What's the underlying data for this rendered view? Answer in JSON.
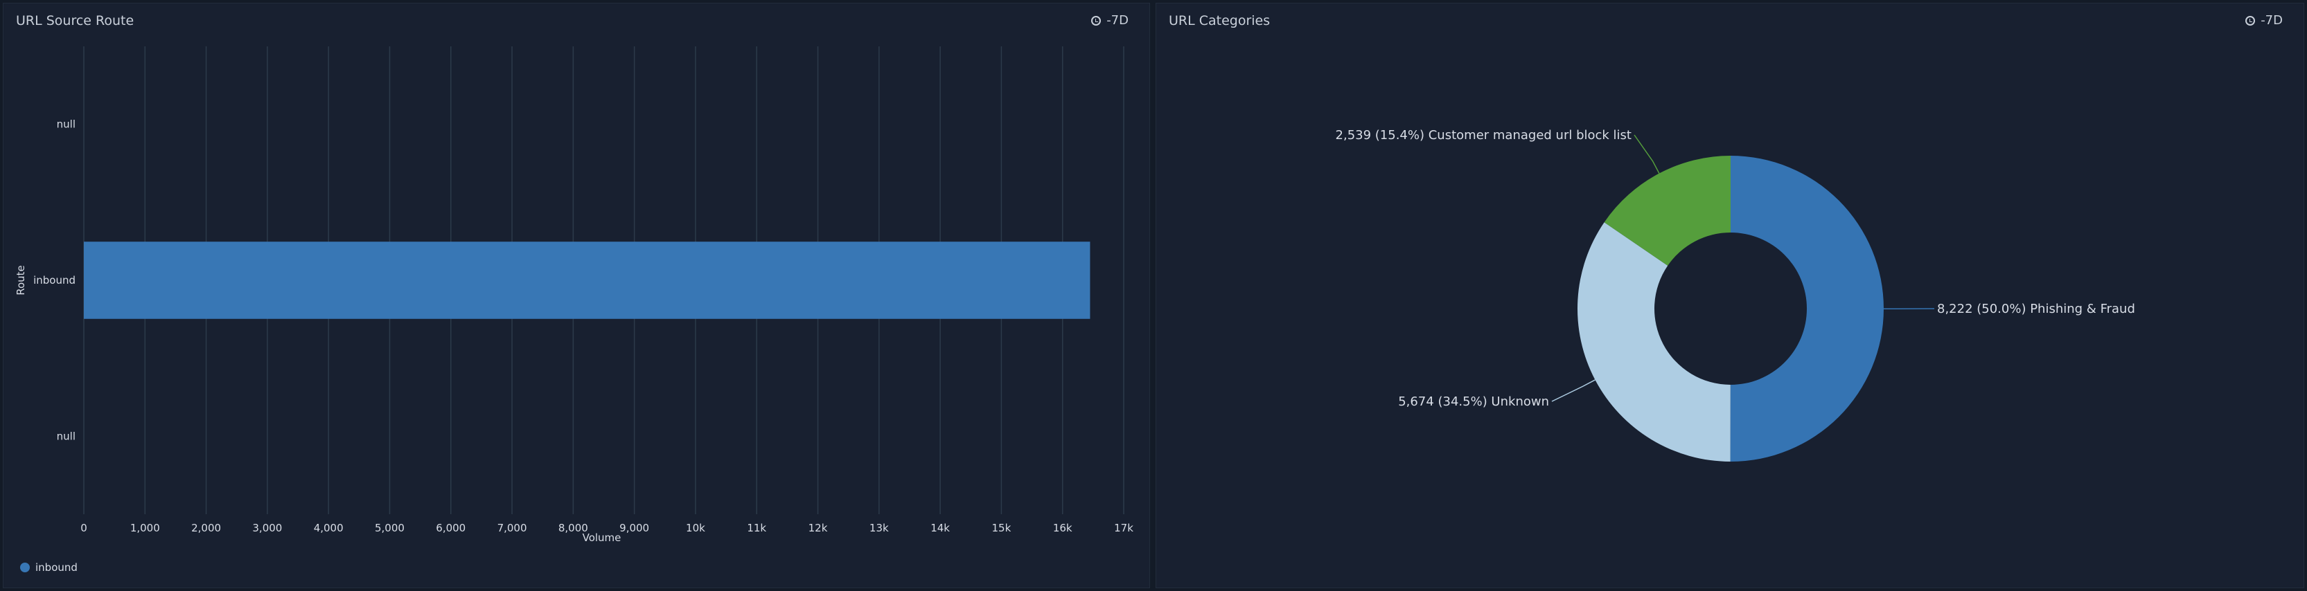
{
  "left_panel": {
    "title": "URL Source Route",
    "time_range": "-7D",
    "legend_label": "inbound"
  },
  "right_panel": {
    "title": "URL Categories",
    "time_range": "-7D"
  },
  "colors": {
    "bar": "#3877b5",
    "phishing": "#3574b3",
    "unknown": "#aecde3",
    "blocklist": "#559e3c",
    "grid": "#2c3a4a",
    "text": "#d8dde6"
  },
  "chart_data": [
    {
      "type": "bar",
      "orientation": "horizontal",
      "categories": [
        "null",
        "inbound",
        "null"
      ],
      "values": [
        0,
        16450,
        0
      ],
      "ylabel": "Route",
      "xlabel": "Volume",
      "xlim": [
        0,
        17000
      ],
      "xticks": [
        0,
        1000,
        2000,
        3000,
        4000,
        5000,
        6000,
        7000,
        8000,
        9000,
        10000,
        11000,
        12000,
        13000,
        14000,
        15000,
        16000,
        17000
      ],
      "xtick_labels": [
        "0",
        "1,000",
        "2,000",
        "3,000",
        "4,000",
        "5,000",
        "6,000",
        "7,000",
        "8,000",
        "9,000",
        "10k",
        "11k",
        "12k",
        "13k",
        "14k",
        "15k",
        "16k",
        "17k"
      ],
      "grid": true,
      "legend": [
        {
          "name": "inbound"
        }
      ],
      "legend_position": "bottom-left"
    },
    {
      "type": "pie",
      "donut": true,
      "slices": [
        {
          "label": "Phishing & Fraud",
          "value": 8222,
          "percent": 50.0,
          "text": "8,222 (50.0%) Phishing & Fraud"
        },
        {
          "label": "Unknown",
          "value": 5674,
          "percent": 34.5,
          "text": "5,674 (34.5%) Unknown"
        },
        {
          "label": "Customer managed url block list",
          "value": 2539,
          "percent": 15.4,
          "text": "2,539 (15.4%) Customer managed url block list"
        }
      ]
    }
  ]
}
